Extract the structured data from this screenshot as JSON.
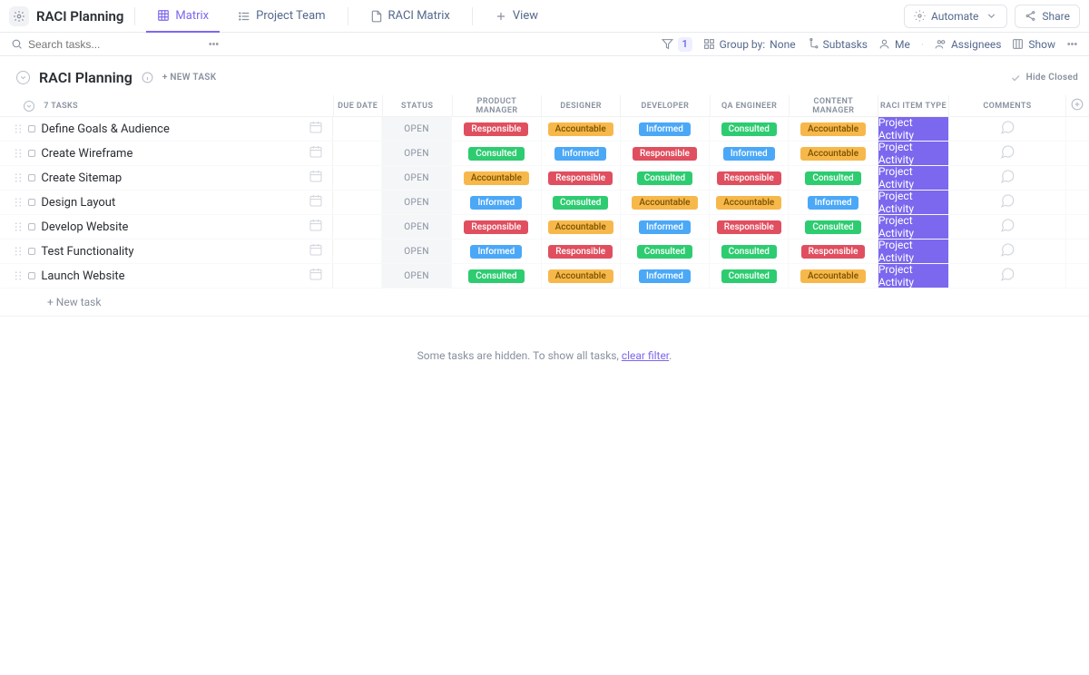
{
  "header": {
    "project_title": "RACI Planning",
    "tabs": [
      {
        "label": "Matrix",
        "icon": "table-icon",
        "active": true
      },
      {
        "label": "Project Team",
        "icon": "list-icon",
        "active": false
      },
      {
        "label": "RACI Matrix",
        "icon": "doc-icon",
        "active": false
      }
    ],
    "view_label": "View",
    "automate_label": "Automate",
    "share_label": "Share"
  },
  "toolbar": {
    "search_placeholder": "Search tasks...",
    "filter_count": "1",
    "group_by_label": "Group by:",
    "group_by_value": "None",
    "subtasks_label": "Subtasks",
    "me_label": "Me",
    "assignees_label": "Assignees",
    "show_label": "Show"
  },
  "list": {
    "title": "RACI Planning",
    "new_task_label": "+ New Task",
    "hide_closed_label": "Hide Closed",
    "tasks_count_label": "7 tasks",
    "new_task_row_label": "+ New task"
  },
  "columns": {
    "due": "Due Date",
    "status": "Status",
    "pm": "Product Manager",
    "designer": "Designer",
    "developer": "Developer",
    "qa": "QA Engineer",
    "content": "Content Manager",
    "type": "RACI Item Type",
    "comments": "Comments"
  },
  "status_open": "OPEN",
  "type_value": "Project Activity",
  "raci_colors": {
    "Responsible": "t-red",
    "Accountable": "t-amber",
    "Informed": "t-blue",
    "Consulted": "t-green"
  },
  "tasks": [
    {
      "name": "Define Goals & Audience",
      "roles": [
        "Responsible",
        "Accountable",
        "Informed",
        "Consulted",
        "Accountable"
      ]
    },
    {
      "name": "Create Wireframe",
      "roles": [
        "Consulted",
        "Informed",
        "Responsible",
        "Informed",
        "Accountable"
      ]
    },
    {
      "name": "Create Sitemap",
      "roles": [
        "Accountable",
        "Responsible",
        "Consulted",
        "Responsible",
        "Consulted"
      ]
    },
    {
      "name": "Design Layout",
      "roles": [
        "Informed",
        "Consulted",
        "Accountable",
        "Accountable",
        "Informed"
      ]
    },
    {
      "name": "Develop Website",
      "roles": [
        "Responsible",
        "Accountable",
        "Informed",
        "Responsible",
        "Consulted"
      ]
    },
    {
      "name": "Test Functionality",
      "roles": [
        "Informed",
        "Responsible",
        "Consulted",
        "Consulted",
        "Responsible"
      ]
    },
    {
      "name": "Launch Website",
      "roles": [
        "Consulted",
        "Accountable",
        "Informed",
        "Consulted",
        "Accountable"
      ]
    }
  ],
  "footer": {
    "hidden_prefix": "Some tasks are hidden. To show all tasks, ",
    "clear_filter": "clear filter",
    "hidden_suffix": "."
  }
}
